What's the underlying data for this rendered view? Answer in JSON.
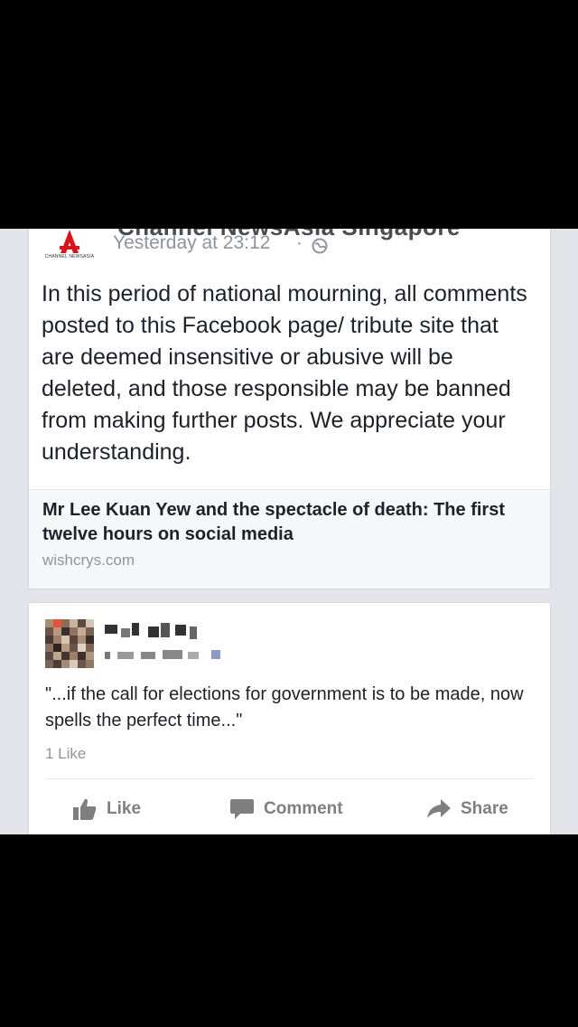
{
  "post": {
    "page_name": "Channel NewsAsia Singapore",
    "logo_text": "CHANNEL NEWSASIA",
    "timestamp": "Yesterday at 23:12",
    "separator": "·",
    "body": "In this period of national mourning, all comments posted to this Facebook page/ tribute site that are deemed insensitive or abusive will be deleted, and those responsible may be banned from making further posts. We appreciate your understanding.",
    "link": {
      "title": "Mr Lee Kuan Yew and the spectacle of death: The first twelve hours on social media",
      "domain": "wishcrys.com"
    }
  },
  "comment": {
    "text": "\"...if the call for elections for government is to be made, now spells the perfect time...\"",
    "likes": "1 Like"
  },
  "actions": {
    "like": "Like",
    "comment": "Comment",
    "share": "Share"
  },
  "icons": {
    "globe": "globe-icon",
    "like": "thumbs-up-icon",
    "comment": "comment-bubble-icon",
    "share": "share-arrow-icon"
  },
  "colors": {
    "logo_red": "#d7141a",
    "meta_gray": "#8d949e",
    "action_gray": "#7f7f7f",
    "background": "#e3e4e9"
  }
}
